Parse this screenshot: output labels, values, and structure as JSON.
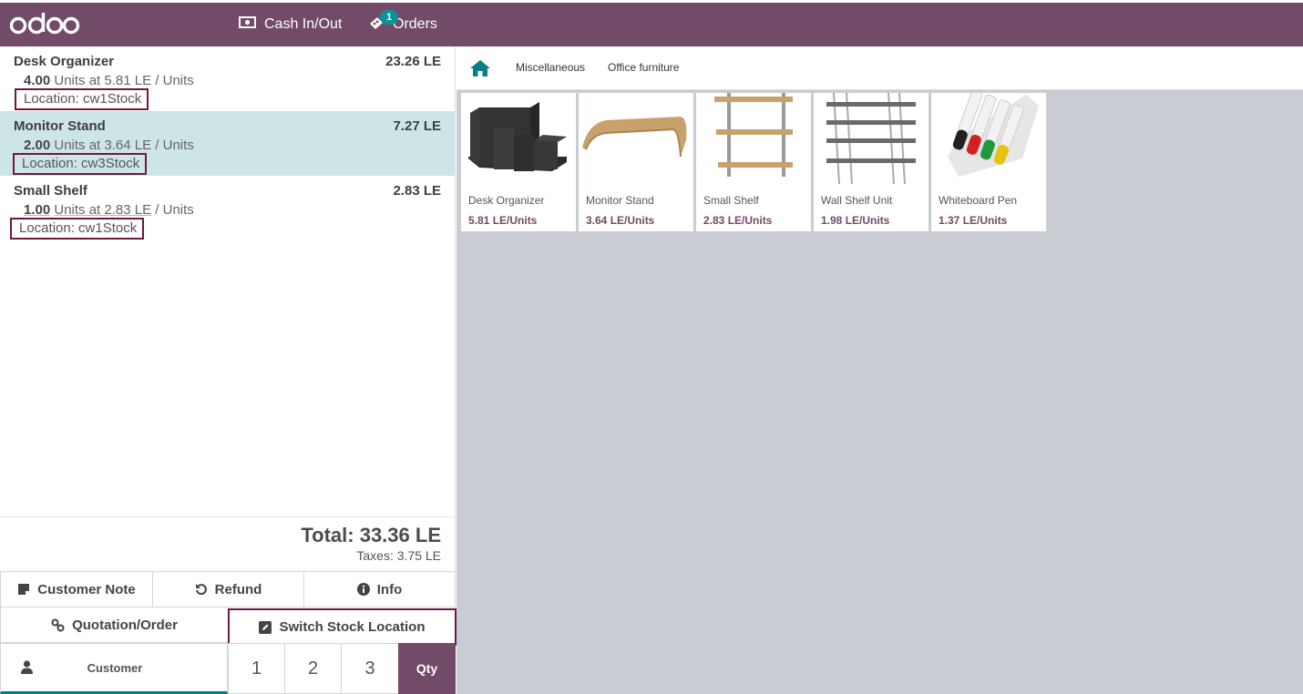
{
  "topbar": {
    "logo": "odoo",
    "cash_label": "Cash In/Out",
    "orders_label": "Orders",
    "orders_count": "1",
    "bg_color": "#714b67"
  },
  "order": {
    "lines": [
      {
        "name": "Desk Organizer",
        "price": "23.26 LE",
        "qty": "4.00",
        "unit_text": "Units at 5.81 LE",
        "unit_suffix": " / Units",
        "location": "Location: cw1Stock",
        "selected": false
      },
      {
        "name": "Monitor Stand",
        "price": "7.27 LE",
        "qty": "2.00",
        "unit_text": "Units at 3.64 LE",
        "unit_suffix": " / Units",
        "location": "Location: cw3Stock",
        "selected": true
      },
      {
        "name": "Small Shelf",
        "price": "2.83 LE",
        "qty": "1.00",
        "unit_text": "Units at 2.83 LE",
        "unit_suffix": " / Units",
        "location": "Location: cw1Stock",
        "selected": false
      }
    ],
    "total": "Total: 33.36 LE",
    "taxes": "Taxes: 3.75 LE"
  },
  "controls": {
    "customer_note": "Customer Note",
    "refund": "Refund",
    "info": "Info",
    "quotation": "Quotation/Order",
    "switch_stock": "Switch Stock Location"
  },
  "numpad": {
    "customer": "Customer",
    "keys": [
      "1",
      "2",
      "3"
    ],
    "qty": "Qty"
  },
  "categories": {
    "items": [
      "Miscellaneous",
      "Office furniture"
    ]
  },
  "products": [
    {
      "name": "Desk Organizer",
      "price": "5.81 LE/Units"
    },
    {
      "name": "Monitor Stand",
      "price": "3.64 LE/Units"
    },
    {
      "name": "Small Shelf",
      "price": "2.83 LE/Units"
    },
    {
      "name": "Wall Shelf Unit",
      "price": "1.98 LE/Units"
    },
    {
      "name": "Whiteboard Pen",
      "price": "1.37 LE/Units"
    }
  ]
}
